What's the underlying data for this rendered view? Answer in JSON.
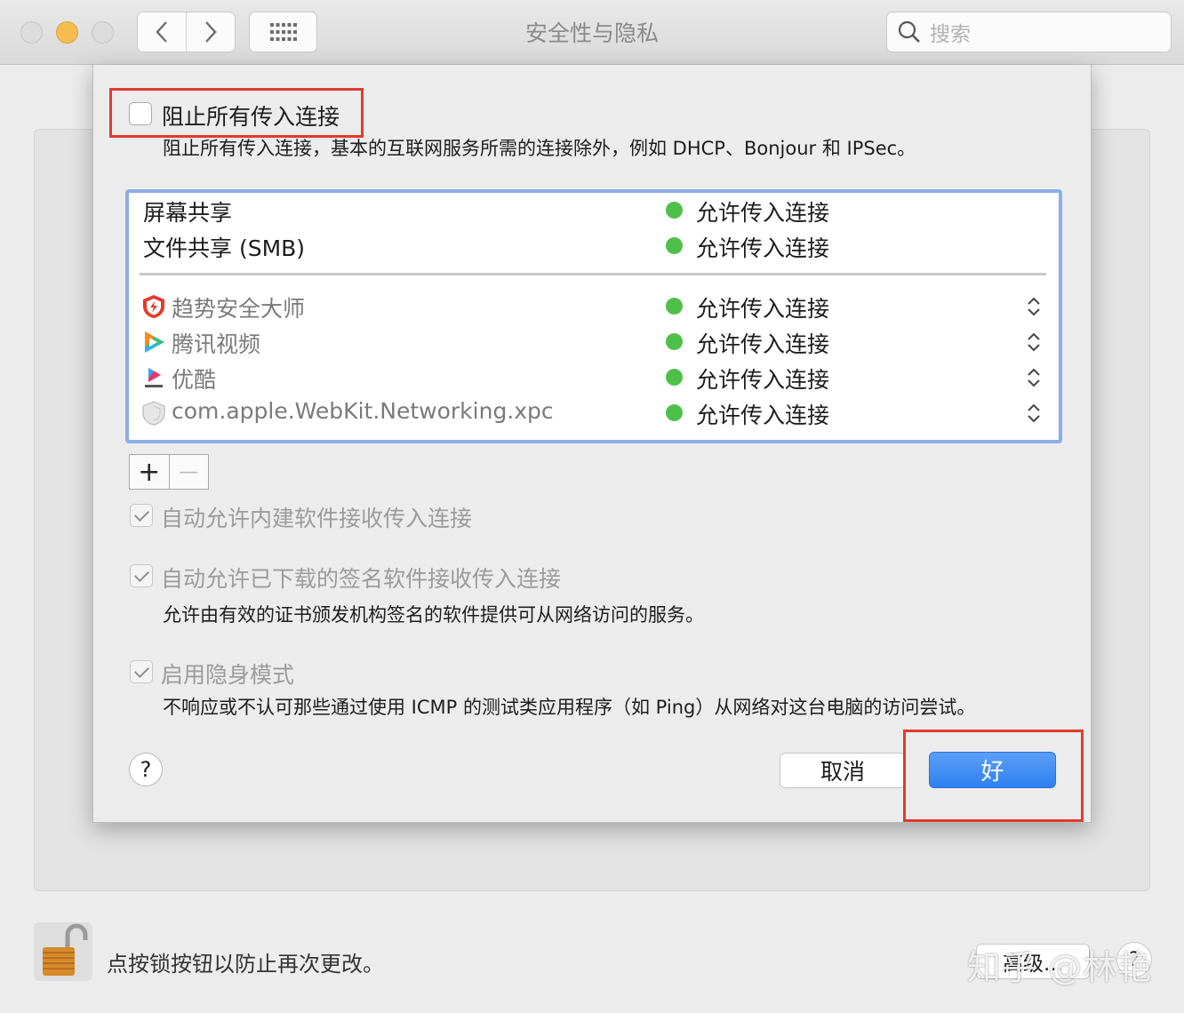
{
  "window": {
    "title": "安全性与隐私",
    "search_placeholder": "搜索"
  },
  "firewall_options": {
    "block_all": {
      "label": "阻止所有传入连接",
      "checked": false,
      "description": "阻止所有传入连接，基本的互联网服务所需的连接除外，例如 DHCP、Bonjour 和 IPSec。"
    },
    "services": [
      {
        "name": "屏幕共享",
        "status": "允许传入连接"
      },
      {
        "name": "文件共享 (SMB)",
        "status": "允许传入连接"
      }
    ],
    "apps": [
      {
        "name": "趋势安全大师",
        "icon": "trend-micro-icon",
        "status": "允许传入连接"
      },
      {
        "name": "腾讯视频",
        "icon": "tencent-video-icon",
        "status": "允许传入连接"
      },
      {
        "name": "优酷",
        "icon": "youku-icon",
        "status": "允许传入连接"
      },
      {
        "name": "com.apple.WebKit.Networking.xpc",
        "icon": "generic-app-icon",
        "status": "允许传入连接"
      }
    ],
    "add_label": "+",
    "remove_label": "—",
    "auto_builtin": {
      "label": "自动允许内建软件接收传入连接",
      "checked": true
    },
    "auto_signed": {
      "label": "自动允许已下载的签名软件接收传入连接",
      "checked": true,
      "description": "允许由有效的证书颁发机构签名的软件提供可从网络访问的服务。"
    },
    "stealth": {
      "label": "启用隐身模式",
      "checked": true,
      "description": "不响应或不认可那些通过使用 ICMP 的测试类应用程序（如 Ping）从网络对这台电脑的访问尝试。"
    },
    "help_label": "?",
    "cancel_label": "取消",
    "ok_label": "好"
  },
  "footer": {
    "lock_text": "点按锁按钮以防止再次更改。",
    "advanced_label": "高级...",
    "help_label": "?",
    "watermark": "知乎 @林艳"
  },
  "colors": {
    "status_dot": "#4ec04a",
    "ok_button": "#2f7ff0",
    "highlight_box": "#e03b2e"
  }
}
